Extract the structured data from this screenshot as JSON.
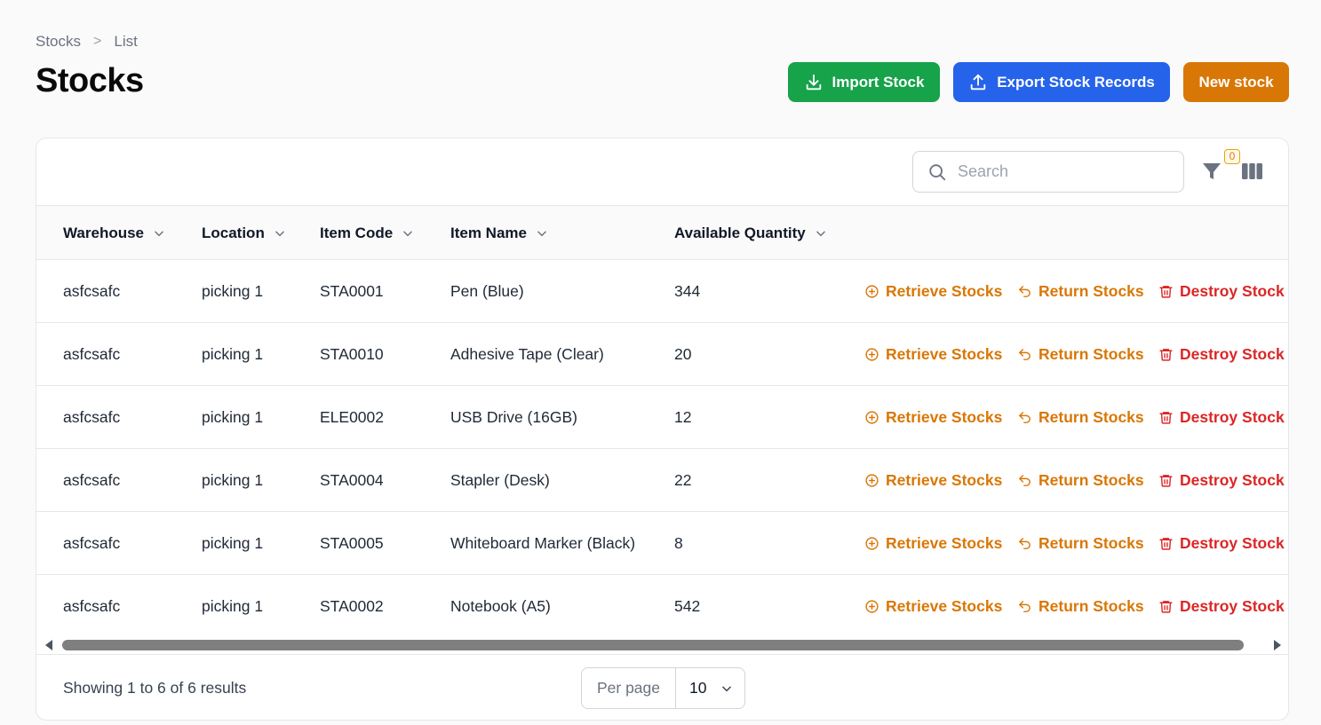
{
  "breadcrumb": {
    "items": [
      "Stocks",
      "List"
    ],
    "separator": ">"
  },
  "page_title": "Stocks",
  "actions": {
    "import_label": "Import Stock",
    "export_label": "Export Stock Records",
    "new_label": "New stock"
  },
  "toolbar": {
    "search_placeholder": "Search",
    "filter_count": "0"
  },
  "table": {
    "columns": [
      "Warehouse",
      "Location",
      "Item Code",
      "Item Name",
      "Available Quantity"
    ],
    "row_actions": {
      "retrieve": "Retrieve Stocks",
      "return": "Return Stocks",
      "destroy": "Destroy Stock"
    },
    "rows": [
      {
        "warehouse": "asfcsafc",
        "location": "picking 1",
        "item_code": "STA0001",
        "item_name": "Pen (Blue)",
        "quantity": "344"
      },
      {
        "warehouse": "asfcsafc",
        "location": "picking 1",
        "item_code": "STA0010",
        "item_name": "Adhesive Tape (Clear)",
        "quantity": "20"
      },
      {
        "warehouse": "asfcsafc",
        "location": "picking 1",
        "item_code": "ELE0002",
        "item_name": "USB Drive (16GB)",
        "quantity": "12"
      },
      {
        "warehouse": "asfcsafc",
        "location": "picking 1",
        "item_code": "STA0004",
        "item_name": "Stapler (Desk)",
        "quantity": "22"
      },
      {
        "warehouse": "asfcsafc",
        "location": "picking 1",
        "item_code": "STA0005",
        "item_name": "Whiteboard Marker (Black)",
        "quantity": "8"
      },
      {
        "warehouse": "asfcsafc",
        "location": "picking 1",
        "item_code": "STA0002",
        "item_name": "Notebook (A5)",
        "quantity": "542"
      }
    ]
  },
  "footer": {
    "showing": "Showing 1 to 6 of 6 results",
    "per_page_label": "Per page",
    "per_page_value": "10"
  },
  "colors": {
    "import": "#16a34a",
    "export": "#2563eb",
    "new": "#d97706",
    "retrieve": "#d97706",
    "return": "#d97706",
    "destroy": "#dc2626"
  },
  "icons": {
    "import": "download-icon",
    "export": "upload-icon",
    "search": "search-icon",
    "filter": "filter-icon",
    "columns": "columns-icon",
    "retrieve": "plus-circle-icon",
    "return": "return-arrow-icon",
    "destroy": "trash-icon",
    "sort": "chevron-down-icon"
  }
}
